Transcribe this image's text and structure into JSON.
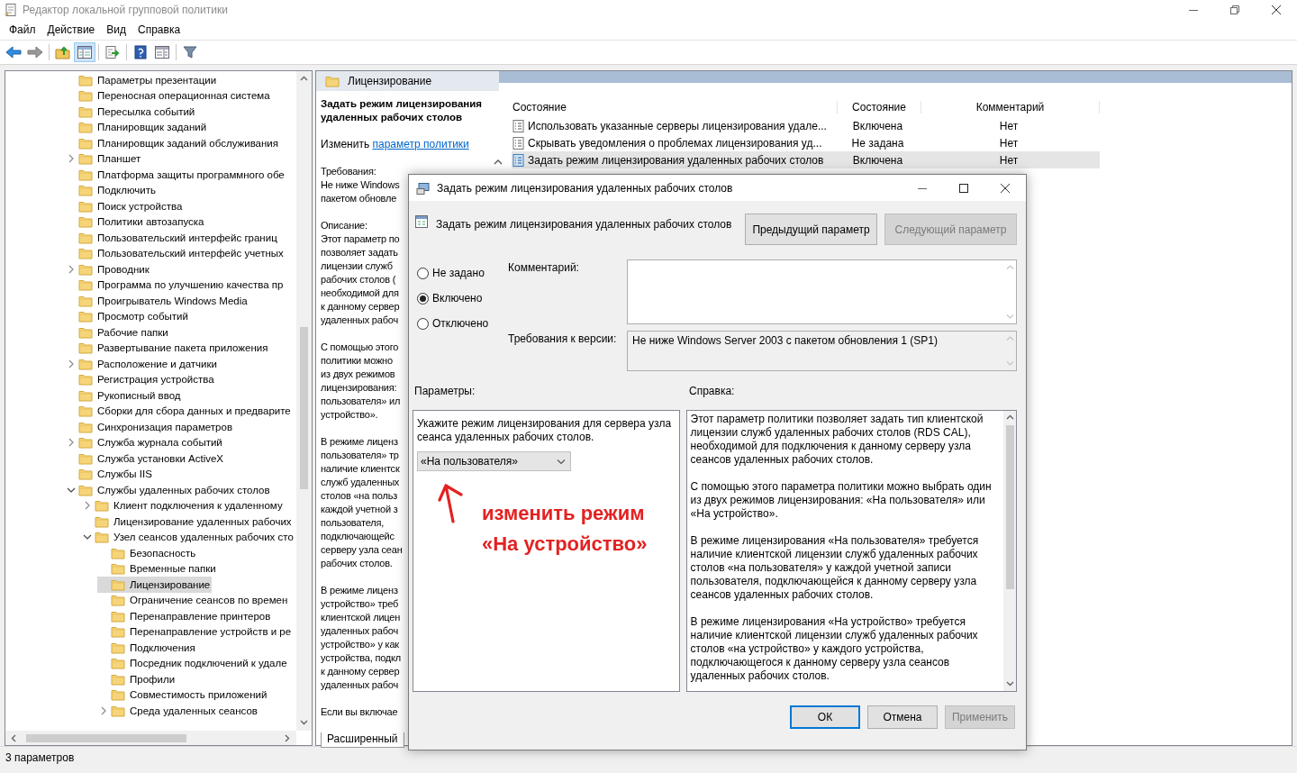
{
  "window": {
    "title": "Редактор локальной групповой политики"
  },
  "menu": [
    "Файл",
    "Действие",
    "Вид",
    "Справка"
  ],
  "toolbar": [
    {
      "kind": "back",
      "pressed": false
    },
    {
      "kind": "forward",
      "pressed": false
    },
    {
      "kind": "up",
      "pressed": false
    },
    {
      "kind": "tree",
      "pressed": true
    },
    {
      "kind": "export",
      "pressed": false
    },
    {
      "kind": "help",
      "pressed": false
    },
    {
      "kind": "view",
      "pressed": false
    },
    {
      "kind": "filter",
      "pressed": false
    }
  ],
  "tree": [
    {
      "label": "Параметры презентации",
      "kind": "leaf",
      "selected": false
    },
    {
      "label": "Переносная операционная система",
      "kind": "leaf",
      "selected": false
    },
    {
      "label": "Пересылка событий",
      "kind": "leaf",
      "selected": false
    },
    {
      "label": "Планировщик заданий",
      "kind": "leaf",
      "selected": false
    },
    {
      "label": "Планировщик заданий обслуживания",
      "kind": "leaf",
      "selected": false
    },
    {
      "label": "Планшет",
      "kind": "collapsed",
      "selected": false
    },
    {
      "label": "Платформа защиты программного обе",
      "kind": "leaf",
      "selected": false
    },
    {
      "label": "Подключить",
      "kind": "leaf",
      "selected": false
    },
    {
      "label": "Поиск устройства",
      "kind": "leaf",
      "selected": false
    },
    {
      "label": "Политики автозапуска",
      "kind": "leaf",
      "selected": false
    },
    {
      "label": "Пользовательский интерфейс границ",
      "kind": "leaf",
      "selected": false
    },
    {
      "label": "Пользовательский интерфейс учетных",
      "kind": "leaf",
      "selected": false
    },
    {
      "label": "Проводник",
      "kind": "collapsed",
      "selected": false
    },
    {
      "label": "Программа по улучшению качества пр",
      "kind": "leaf",
      "selected": false
    },
    {
      "label": "Проигрыватель Windows Media",
      "kind": "leaf",
      "selected": false
    },
    {
      "label": "Просмотр событий",
      "kind": "leaf",
      "selected": false
    },
    {
      "label": "Рабочие папки",
      "kind": "leaf",
      "selected": false
    },
    {
      "label": "Развертывание пакета приложения",
      "kind": "leaf",
      "selected": false
    },
    {
      "label": "Расположение и датчики",
      "kind": "collapsed",
      "selected": false
    },
    {
      "label": "Регистрация устройства",
      "kind": "leaf",
      "selected": false
    },
    {
      "label": "Рукописный ввод",
      "kind": "leaf",
      "selected": false
    },
    {
      "label": "Сборки для сбора данных и предварите",
      "kind": "leaf",
      "selected": false
    },
    {
      "label": "Синхронизация параметров",
      "kind": "leaf",
      "selected": false
    },
    {
      "label": "Служба журнала событий",
      "kind": "collapsed",
      "selected": false
    },
    {
      "label": "Служба установки ActiveX",
      "kind": "leaf",
      "selected": false
    },
    {
      "label": "Службы IIS",
      "kind": "leaf",
      "selected": false
    },
    {
      "label": "Службы удаленных рабочих столов",
      "kind": "expanded",
      "selected": false,
      "children": [
        {
          "label": "Клиент подключения к удаленному",
          "kind": "collapsed",
          "selected": false
        },
        {
          "label": "Лицензирование удаленных рабочих",
          "kind": "leaf",
          "selected": false
        },
        {
          "label": "Узел сеансов удаленных рабочих сто",
          "kind": "expanded",
          "selected": false,
          "children": [
            {
              "label": "Безопасность",
              "kind": "leaf",
              "selected": false
            },
            {
              "label": "Временные папки",
              "kind": "leaf",
              "selected": false
            },
            {
              "label": "Лицензирование",
              "kind": "leaf",
              "selected": true
            },
            {
              "label": "Ограничение сеансов по времен",
              "kind": "leaf",
              "selected": false
            },
            {
              "label": "Перенаправление принтеров",
              "kind": "leaf",
              "selected": false
            },
            {
              "label": "Перенаправление устройств и ре",
              "kind": "leaf",
              "selected": false
            },
            {
              "label": "Подключения",
              "kind": "leaf",
              "selected": false
            },
            {
              "label": "Посредник подключений к удале",
              "kind": "leaf",
              "selected": false
            },
            {
              "label": "Профили",
              "kind": "leaf",
              "selected": false
            },
            {
              "label": "Совместимость приложений",
              "kind": "leaf",
              "selected": false
            },
            {
              "label": "Среда удаленных сеансов",
              "kind": "collapsed",
              "selected": false
            }
          ]
        }
      ]
    }
  ],
  "details": {
    "title": "Лицензирование",
    "extended": {
      "policy_title": "Задать режим лицензирования удаленных рабочих столов",
      "edit_prefix": "Изменить",
      "edit_link": "параметр политики",
      "paragraphs": [
        [
          "Требования:",
          "Не ниже Windows",
          "пакетом обновле"
        ],
        [
          "Описание:",
          "Этот параметр по",
          "позволяет задать",
          "лицензии служб",
          "рабочих столов (",
          "необходимой для",
          "к данному сервер",
          "удаленных рабоч"
        ],
        [
          "С помощью этого",
          "политики можно",
          "из двух режимов",
          "лицензирования:",
          "пользователя» ил",
          "устройство»."
        ],
        [
          "В режиме лиценз",
          "пользователя» тр",
          "наличие клиентск",
          "служб удаленных",
          "столов «на польз",
          "каждой учетной з",
          "пользователя,",
          "подключающейс",
          "серверу узла сеан",
          "рабочих столов."
        ],
        [
          "В режиме лиценз",
          "устройство» треб",
          "клиентской лицен",
          "удаленных рабоч",
          "устройство» у как",
          "устройства, подкл",
          "к данному сервер",
          "удаленных рабоч"
        ],
        [
          "Если вы включае"
        ]
      ]
    },
    "view_tabs": [
      {
        "label": "Расширенный",
        "selected": true
      }
    ],
    "columns": [
      "Состояние",
      "Состояние",
      "Комментарий"
    ],
    "rows": [
      {
        "name": "Использовать указанные серверы лицензирования удале...",
        "state": "Включена",
        "comment": "Нет",
        "selected": false
      },
      {
        "name": "Скрывать уведомления о проблемах лицензирования уд...",
        "state": "Не задана",
        "comment": "Нет",
        "selected": false
      },
      {
        "name": "Задать режим лицензирования удаленных рабочих столов",
        "state": "Включена",
        "comment": "Нет",
        "selected": true
      }
    ]
  },
  "status_bar": "3 параметров",
  "dialog": {
    "title": "Задать режим лицензирования удаленных рабочих столов",
    "heading": "Задать режим лицензирования удаленных рабочих столов",
    "nav_buttons": [
      {
        "label": "Предыдущий параметр",
        "disabled": false
      },
      {
        "label": "Следующий параметр",
        "disabled": true
      }
    ],
    "states": [
      {
        "label": "Не задано",
        "selected": false
      },
      {
        "label": "Включено",
        "selected": true
      },
      {
        "label": "Отключено",
        "selected": false
      }
    ],
    "comment_label": "Комментарий:",
    "requirements_label": "Требования к версии:",
    "requirements": "Не ниже Windows Server 2003 с пакетом обновления 1 (SP1)",
    "options_label": "Параметры:",
    "help_label": "Справка:",
    "option_text": "Укажите режим лицензирования для сервера узла сеанса удаленных рабочих столов.",
    "mode_value": "«На пользователя»",
    "annotation": [
      "изменить режим",
      "«На устройство»"
    ],
    "help_paragraphs": [
      "Этот параметр политики позволяет задать тип клиентской лицензии служб удаленных рабочих столов (RDS CAL), необходимой для подключения к данному серверу узла сеансов удаленных рабочих столов.",
      "С помощью этого параметра политики можно выбрать один из двух режимов лицензирования: «На пользователя» или «На устройство».",
      "В режиме лицензирования «На пользователя» требуется наличие клиентской лицензии служб удаленных рабочих столов «на пользователя» у каждой учетной записи пользователя, подключающейся к данному серверу узла сеансов удаленных рабочих столов.",
      "В режиме лицензирования «На устройство» требуется наличие клиентской лицензии служб удаленных рабочих столов «на устройство» у каждого устройства, подключающегося к данному серверу узла сеансов удаленных рабочих столов."
    ],
    "buttons": [
      {
        "label": "ОК",
        "disabled": false,
        "focused": true
      },
      {
        "label": "Отмена",
        "disabled": false,
        "focused": false
      },
      {
        "label": "Применить",
        "disabled": true,
        "focused": false
      }
    ]
  }
}
